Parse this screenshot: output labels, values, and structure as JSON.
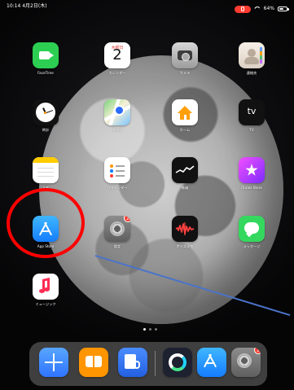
{
  "status": {
    "time": "10:14",
    "date": "4月2日(木)",
    "battery": "64%",
    "battery_fill": 0.64
  },
  "calendar_icon": {
    "weekday": "木曜日",
    "day": "2"
  },
  "tv_icon": {
    "text": "tv"
  },
  "apps": {
    "facetime": "FaceTime",
    "calendar": "カレンダー",
    "camera": "カメラ",
    "contacts": "連絡先",
    "clock": "時計",
    "maps": "マップ",
    "home": "ホーム",
    "tv": "TV",
    "notes": "メモ",
    "reminders": "リマインダー",
    "stocks": "株価",
    "itunes": "iTunes Store",
    "appstore": "App Store",
    "settings": "設定",
    "voice_memos": "ボイスメモ",
    "messages": "メッセージ",
    "music": "ミュージック"
  },
  "badges": {
    "settings": "2",
    "dock_settings": "2"
  },
  "icons": {
    "status_mic": "mic-icon",
    "wifi": "wifi-icon",
    "battery": "battery-icon",
    "facetime": "video-camera-icon",
    "calendar": "calendar-icon",
    "camera": "camera-icon",
    "contacts": "contacts-icon",
    "clock": "clock-icon",
    "maps": "map-icon",
    "home": "home-icon",
    "tv": "tv-icon",
    "notes": "notes-icon",
    "reminders": "reminders-icon",
    "stocks": "stocks-icon",
    "itunes": "star-icon",
    "appstore": "app-store-icon",
    "settings": "settings-gear-icon",
    "voice_memos": "waveform-icon",
    "messages": "message-bubble-icon",
    "music": "music-note-icon",
    "dock_split": "split-view-icon",
    "dock_books": "book-icon",
    "dock_voice_memo": "voice-memo-icon",
    "dock_spiral": "spiral-app-icon",
    "dock_appstore": "app-store-icon",
    "dock_settings": "settings-gear-icon"
  },
  "colors": {
    "highlight_ring": "#ff0000",
    "pointer_line": "#4b74c9"
  }
}
